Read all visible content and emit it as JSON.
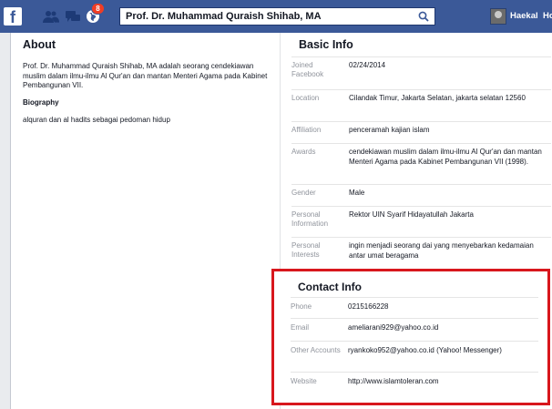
{
  "topbar": {
    "logo": "f",
    "notification_count": "8",
    "search_value": "Prof. Dr. Muhammad Quraish Shihab, MA",
    "user_name": "Haekal",
    "next_label": "Ho"
  },
  "about": {
    "title": "About",
    "text": "Prof. Dr. Muhammad Quraish Shihab, MA adalah seorang cendekiawan muslim dalam ilmu-ilmu Al Qur'an dan mantan Menteri Agama pada Kabinet Pembangunan VII.",
    "biography_title": "Biography",
    "biography_text": "alquran dan al hadits sebagai pedoman hidup"
  },
  "basic_info": {
    "title": "Basic Info",
    "rows": [
      {
        "label": "Joined Facebook",
        "value": "02/24/2014"
      },
      {
        "label": "Location",
        "value": "Cilandak Timur, Jakarta Selatan, jakarta selatan 12560"
      },
      {
        "label": "Affiliation",
        "value": "penceramah kajian islam"
      },
      {
        "label": "Awards",
        "value": "cendekiawan muslim dalam ilmu-ilmu Al Qur'an dan mantan Menteri Agama pada Kabinet Pembangunan VII (1998)."
      },
      {
        "label": "Gender",
        "value": "Male"
      },
      {
        "label": "Personal Information",
        "value": "Rektor UIN Syarif Hidayatullah Jakarta"
      },
      {
        "label": "Personal Interests",
        "value": "ingin menjadi seorang dai yang menyebarkan kedamaian antar umat beragama"
      }
    ]
  },
  "contact_info": {
    "title": "Contact Info",
    "rows": [
      {
        "label": "Phone",
        "value": "0215166228"
      },
      {
        "label": "Email",
        "value": "ameliarani929@yahoo.co.id"
      },
      {
        "label": "Other Accounts",
        "value": "ryankoko952@yahoo.co.id  (Yahoo! Messenger)"
      },
      {
        "label": "Website",
        "value": "http://www.islamtoleran.com"
      }
    ]
  },
  "colors": {
    "brand_blue": "#3b5998",
    "highlight_red": "#d8171d",
    "label_gray": "#90949c"
  }
}
